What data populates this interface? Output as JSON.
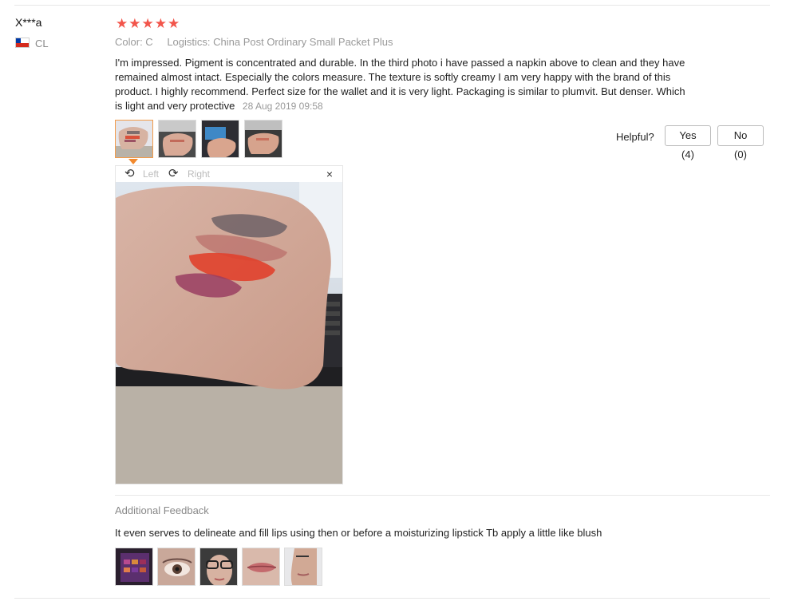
{
  "reviewer": {
    "name": "X***a",
    "country_code": "CL",
    "flag_icon": "chile-flag-icon"
  },
  "rating": {
    "stars": 5,
    "stars_display": "★★★★★",
    "color": "#f2554b"
  },
  "meta": {
    "color": "Color: C",
    "logistics": "Logistics: China Post Ordinary Small Packet Plus"
  },
  "review": {
    "text": "I'm impressed. Pigment is concentrated and durable. In the third photo i have passed a napkin above to clean and they have remained almost intact. Especially the colors measure. The texture is softly creamy I am very happy with the brand of this product. I highly recommend. Perfect size for the wallet and it is very light. Packaging is similar to plumvit. But denser. Which is light and very protective",
    "date": "28 Aug 2019 09:58"
  },
  "helpful": {
    "label": "Helpful?",
    "yes": "Yes (4)",
    "no": "No (0)"
  },
  "viewer": {
    "left": "Left",
    "right": "Right",
    "close_glyph": "×",
    "rotate_left_glyph": "⟲",
    "rotate_right_glyph": "⟳"
  },
  "additional": {
    "label": "Additional Feedback",
    "text": "It even serves to delineate and fill lips using then or before a moisturizing lipstick Tb apply a little like blush"
  }
}
